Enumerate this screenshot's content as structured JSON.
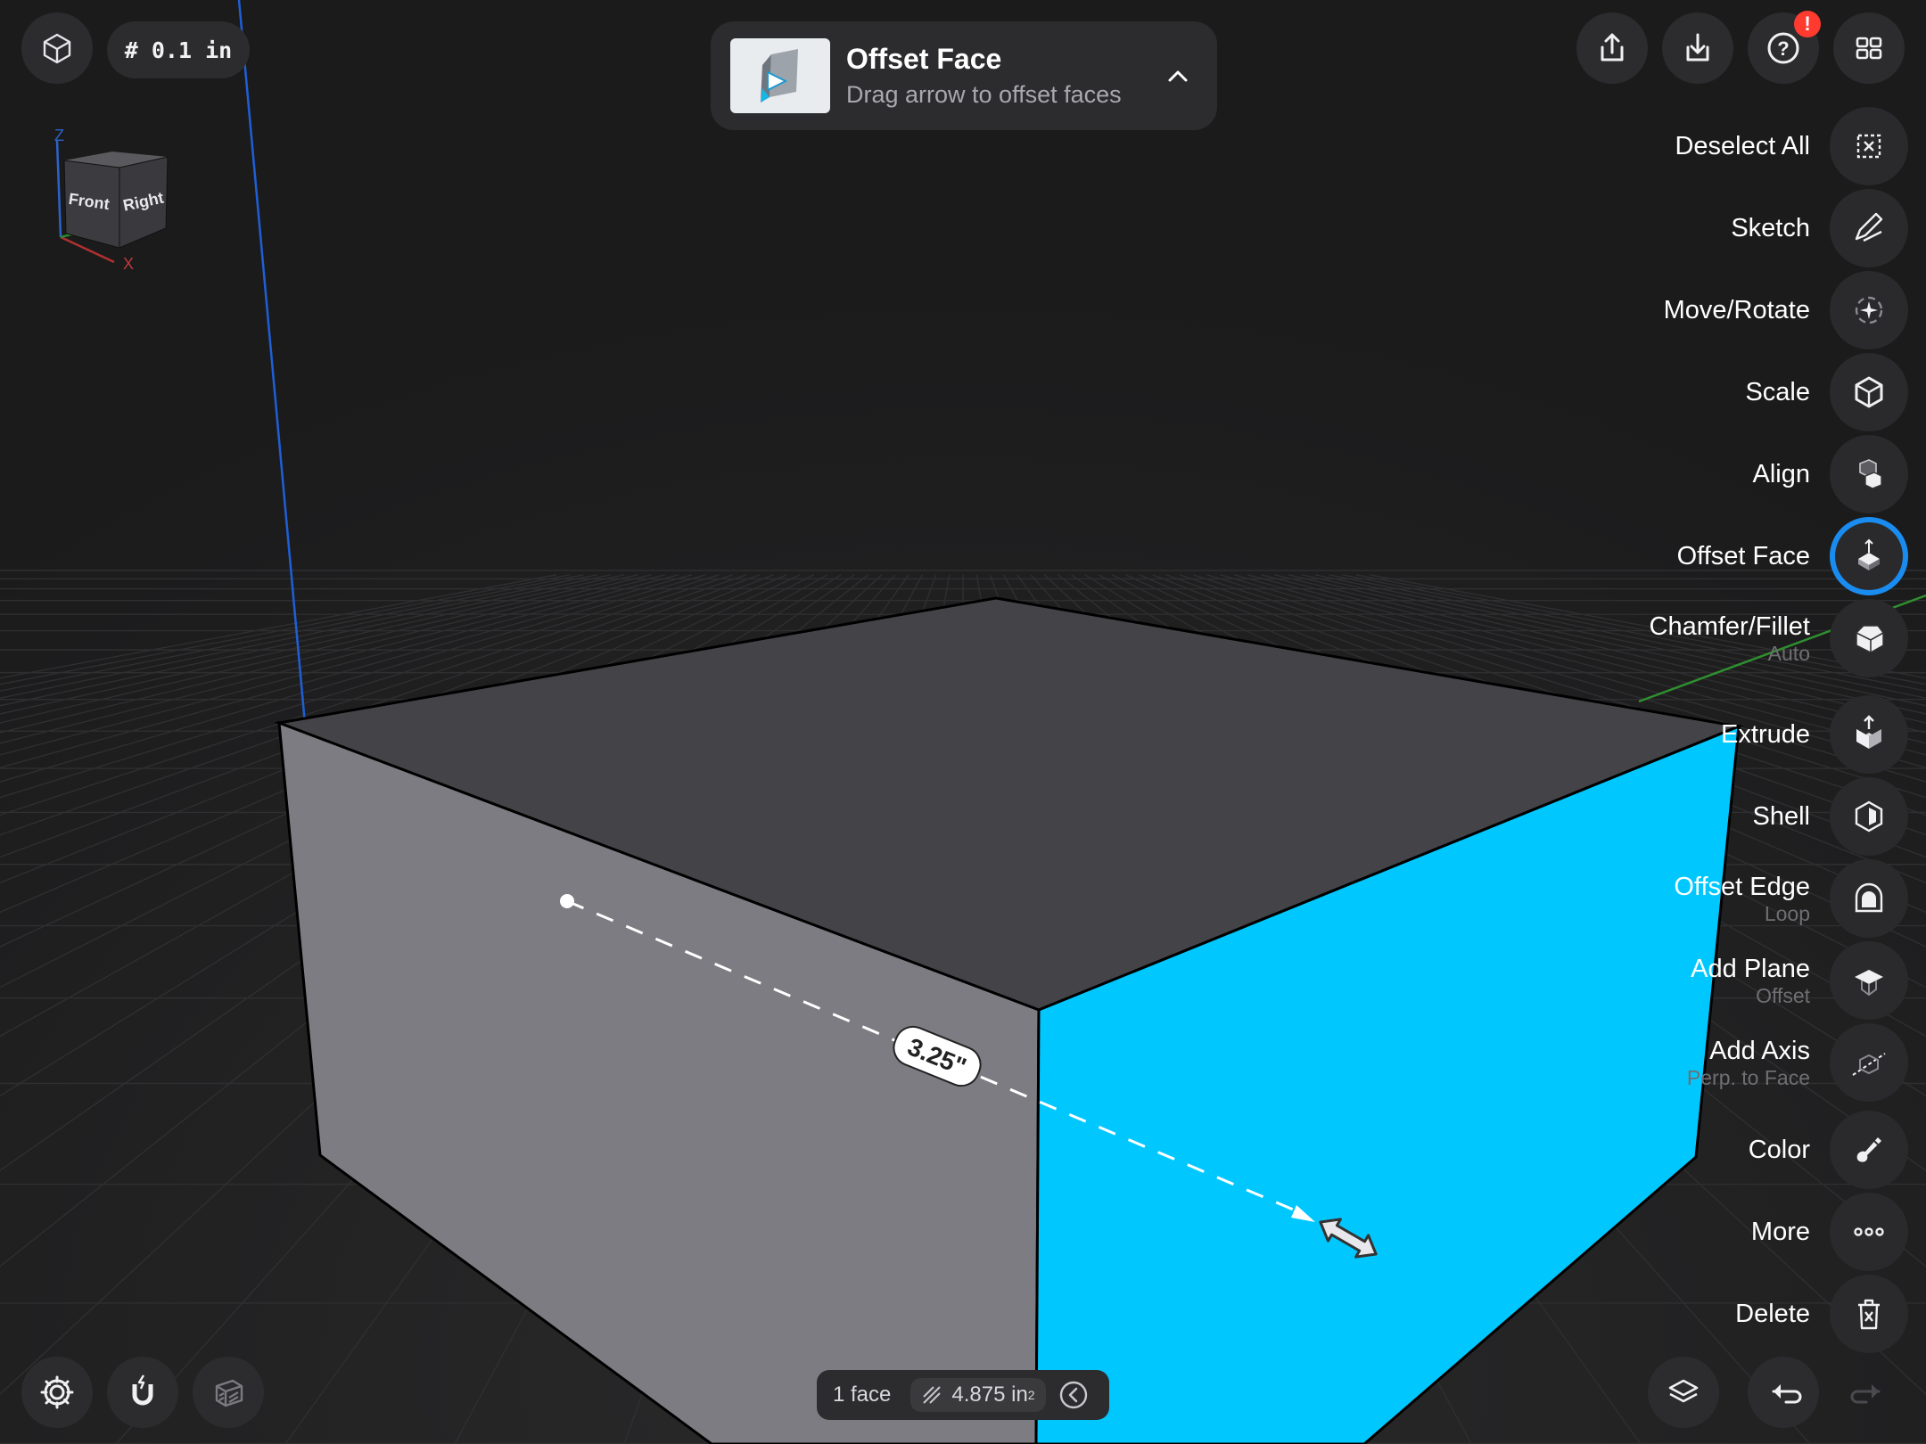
{
  "app": {
    "selected_color": "#00c8ff",
    "accent_blue": "#1a8cf0",
    "badge_red": "#ff3b30"
  },
  "top_left": {
    "view_button_icon": "wireframe-cube-icon",
    "grid_label": "# 0.1 in"
  },
  "view_cube": {
    "front": "Front",
    "right": "Right",
    "axis_z": "Z",
    "axis_x": "X"
  },
  "banner": {
    "title": "Offset Face",
    "subtitle": "Drag arrow to offset faces",
    "collapse_icon": "chevron-up-icon"
  },
  "top_right": {
    "buttons": [
      {
        "icon": "share-icon"
      },
      {
        "icon": "import-icon"
      },
      {
        "icon": "help-icon",
        "badge": "!"
      },
      {
        "icon": "grid-icon"
      }
    ]
  },
  "tools": [
    {
      "label": "Deselect All",
      "icon": "deselect-icon"
    },
    {
      "label": "Sketch",
      "icon": "sketch-pen-icon"
    },
    {
      "label": "Move/Rotate",
      "icon": "move-rotate-icon"
    },
    {
      "label": "Scale",
      "icon": "scale-cube-icon"
    },
    {
      "label": "Align",
      "icon": "align-icon"
    },
    {
      "label": "Offset Face",
      "icon": "offset-face-icon",
      "active": true
    },
    {
      "label": "Chamfer/Fillet",
      "sublabel": "Auto",
      "icon": "chamfer-icon"
    },
    {
      "label": "Extrude",
      "icon": "extrude-icon"
    },
    {
      "label": "Shell",
      "icon": "shell-icon"
    },
    {
      "label": "Offset Edge",
      "sublabel": "Loop",
      "icon": "offset-edge-icon"
    },
    {
      "label": "Add Plane",
      "sublabel": "Offset",
      "icon": "add-plane-icon"
    },
    {
      "label": "Add Axis",
      "sublabel": "Perp. to Face",
      "icon": "add-axis-icon"
    },
    {
      "label": "Color",
      "icon": "color-brush-icon"
    },
    {
      "label": "More",
      "icon": "more-icon"
    },
    {
      "label": "Delete",
      "icon": "trash-icon"
    }
  ],
  "measurement": {
    "label": "3.25\""
  },
  "status": {
    "selection": "1 face",
    "area": "4.875 in",
    "area_exponent": "2",
    "prev_icon": "chevron-left-circle-icon"
  },
  "bottom_left": {
    "buttons": [
      "settings-gear-icon",
      "magnet-snap-icon",
      "section-view-icon"
    ]
  },
  "bottom_right": {
    "buttons": [
      "layers-icon",
      "undo-icon",
      "redo-icon"
    ]
  }
}
